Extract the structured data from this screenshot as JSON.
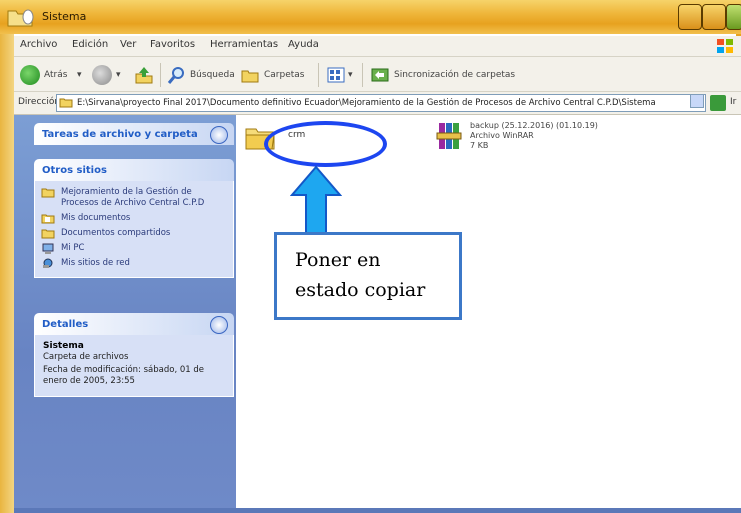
{
  "titlebar": {
    "title": "Sistema"
  },
  "menu": {
    "items": [
      "Archivo",
      "Edición",
      "Ver",
      "Favoritos",
      "Herramientas",
      "Ayuda"
    ]
  },
  "toolbar": {
    "back": "Atrás",
    "search": "Búsqueda",
    "folders": "Carpetas",
    "sync": "Sincronización de carpetas"
  },
  "address": {
    "label": "Dirección",
    "path": "E:\\Sirvana\\proyecto Final 2017\\Documento definitivo Ecuador\\Mejoramiento de la Gestión de Procesos de Archivo Central C.P.D\\Sistema",
    "go": "Ir"
  },
  "pane": {
    "tasks_title": "Tareas de archivo y carpeta",
    "other_title": "Otros sitios",
    "other_items": [
      "Mejoramiento de la Gestión de Procesos de Archivo Central C.P.D",
      "Mis documentos",
      "Documentos compartidos",
      "Mi PC",
      "Mis sitios de red"
    ],
    "details_title": "Detalles",
    "details": {
      "name": "Sistema",
      "type": "Carpeta de archivos",
      "modified": "Fecha de modificación: sábado, 01 de enero de 2005, 23:55"
    }
  },
  "content": {
    "folder_name": "crm",
    "rar_name": "backup (25.12.2016) (01.10.19)",
    "rar_type": "Archivo WinRAR",
    "rar_size": "7 KB"
  },
  "callout": {
    "line1": "Poner en",
    "line2": "estado copiar"
  },
  "colors": {
    "accent": "#1d46f0",
    "callout_border": "#3c78c8",
    "arrow": "#1ea7f0",
    "pane": "#6f8ac8"
  }
}
